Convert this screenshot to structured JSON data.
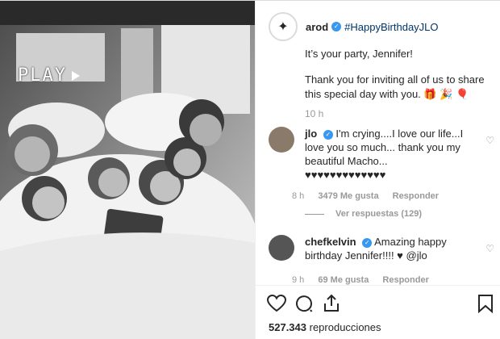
{
  "media": {
    "overlay_text": "PLAY"
  },
  "header": {
    "username": "arod",
    "hashtag": "#HappyBirthdayJLO"
  },
  "caption": {
    "line1": "It’s your party, Jennifer!",
    "line2": "Thank you for inviting all of us to share this special day with you. 🎁 🎉 🎈",
    "time": "10 h"
  },
  "comments": [
    {
      "username": "jlo",
      "text": "I'm crying....I love our life...I love you so much... thank you my beautiful Macho... ♥♥♥♥♥♥♥♥♥♥♥♥♥",
      "time": "8 h",
      "likes": "3479 Me gusta",
      "reply": "Responder"
    },
    {
      "username": "chefkelvin",
      "text": "Amazing happy birthday Jennifer!!!! ♥ @jlo",
      "time": "9 h",
      "likes": "69 Me gusta",
      "reply": "Responder"
    }
  ],
  "replies": {
    "label": "Ver respuestas (129)"
  },
  "footer": {
    "views_count": "527.343",
    "views_label": "reproducciones"
  },
  "icons": {
    "like": "heart-icon",
    "comment": "comment-icon",
    "share": "share-icon",
    "save": "bookmark-icon",
    "verified": "verified-badge-icon"
  },
  "colors": {
    "link": "#003569",
    "verified": "#3897f0",
    "muted": "#999999"
  }
}
